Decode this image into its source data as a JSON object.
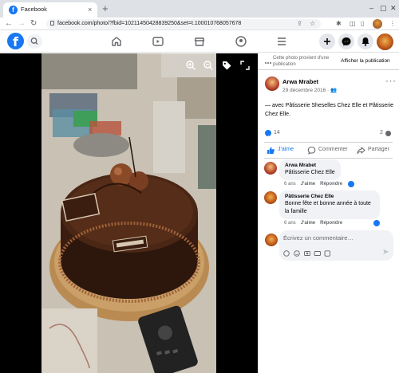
{
  "browser": {
    "tab_title": "Facebook",
    "tab_close": "×",
    "new_tab": "+",
    "url": "facebook.com/photo/?fbid=10211450428839250&set=t.100010768057678",
    "icons": [
      "back-icon",
      "forward-icon",
      "reload-icon",
      "lock-icon",
      "share-icon",
      "star-icon",
      "extensions-icon",
      "reading-list-icon",
      "profile-icon",
      "menu-icon"
    ]
  },
  "header": {
    "logo": "f",
    "nav_icons": [
      "home-icon",
      "watch-icon",
      "marketplace-icon",
      "groups-icon",
      "menu-icon"
    ],
    "right_icons": [
      "create-icon",
      "messenger-icon",
      "notifications-icon",
      "account-icon"
    ]
  },
  "viewer": {
    "tools": [
      "zoom-in-icon",
      "zoom-out-icon",
      "tag-icon",
      "fullscreen-icon"
    ]
  },
  "panel": {
    "notice_text": "Cette photo provient d'une publication",
    "notice_link": "Afficher la publication",
    "author": "Arwa Mrabet",
    "date": "29 décembre 2016 · ",
    "caption": "— avec Pâtisserie Sheselles Chez Elle et Pâtisserie Chez Elle.",
    "reactions_count": "14",
    "comments_count": "2",
    "actions": {
      "like": "J'aime",
      "comment": "Commenter",
      "share": "Partager"
    },
    "comments": [
      {
        "name": "Arwa Mrabet",
        "text": "Pâtisserie Chez Elle",
        "time": "6 ans",
        "like": "J'aime",
        "reply": "Répondre"
      },
      {
        "name": "Pâtisserie Chez Elle",
        "text": "Bonne fête et bonne année à toute la famille",
        "time": "6 ans",
        "like": "J'aime",
        "reply": "Répondre"
      }
    ],
    "comment_placeholder": "Écrivez un commentaire…"
  },
  "colors": {
    "brand": "#1877f2",
    "secondary_text": "#65676b",
    "bubble": "#f0f2f5"
  }
}
